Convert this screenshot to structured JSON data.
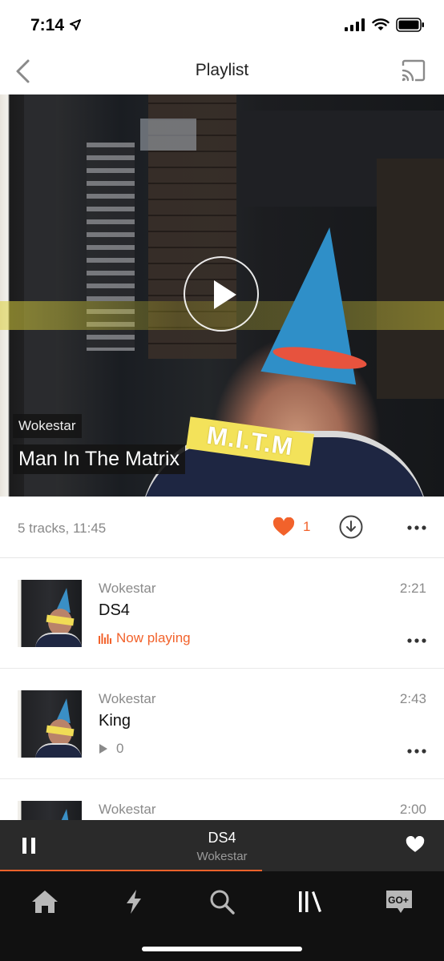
{
  "status_bar": {
    "time": "7:14"
  },
  "nav": {
    "title": "Playlist"
  },
  "hero": {
    "artist": "Wokestar",
    "title": "Man In The Matrix",
    "art_text": "M.I.T.M"
  },
  "meta": {
    "info": "5 tracks, 11:45",
    "likes": "1"
  },
  "tracks": [
    {
      "artist": "Wokestar",
      "title": "DS4",
      "duration": "2:21",
      "status": "Now playing"
    },
    {
      "artist": "Wokestar",
      "title": "King",
      "duration": "2:43",
      "plays": "0"
    },
    {
      "artist": "Wokestar",
      "title": "",
      "duration": "2:00"
    }
  ],
  "mini_player": {
    "title": "DS4",
    "artist": "Wokestar",
    "progress": 0.59
  },
  "tabs": [
    "home-icon",
    "stream-icon",
    "search-icon",
    "library-icon",
    "go-plus-icon"
  ],
  "colors": {
    "accent": "#f2622b",
    "player_bg": "#2a2a2a",
    "tabbar_bg": "#111111"
  }
}
